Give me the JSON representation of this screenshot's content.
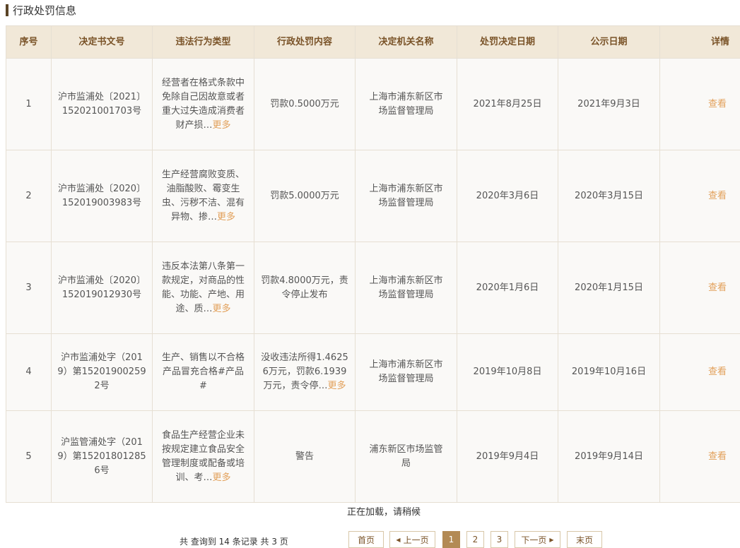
{
  "section_title": "行政处罚信息",
  "table": {
    "headers": [
      "序号",
      "决定书文号",
      "违法行为类型",
      "行政处罚内容",
      "决定机关名称",
      "处罚决定日期",
      "公示日期",
      "详情"
    ],
    "rows": [
      {
        "no": "1",
        "doc_no": "沪市监浦处〔2021〕152021001703号",
        "type": "经营者在格式条款中免除自己因故意或者重大过失造成消费者财产损…",
        "more": "更多",
        "content": "罚款0.5000万元",
        "authority": "上海市浦东新区市场监督管理局",
        "decision_date": "2021年8月25日",
        "publish_date": "2021年9月3日",
        "view": "查看"
      },
      {
        "no": "2",
        "doc_no": "沪市监浦处〔2020〕152019003983号",
        "type": "生产经营腐败变质、油脂酸败、霉变生虫、污秽不洁、混有异物、掺…",
        "more": "更多",
        "content": "罚款5.0000万元",
        "authority": "上海市浦东新区市场监督管理局",
        "decision_date": "2020年3月6日",
        "publish_date": "2020年3月15日",
        "view": "查看"
      },
      {
        "no": "3",
        "doc_no": "沪市监浦处〔2020〕152019012930号",
        "type": "违反本法第八条第一款规定，对商品的性能、功能、产地、用途、质…",
        "more": "更多",
        "content": "罚款4.8000万元，责令停止发布",
        "authority": "上海市浦东新区市场监督管理局",
        "decision_date": "2020年1月6日",
        "publish_date": "2020年1月15日",
        "view": "查看"
      },
      {
        "no": "4",
        "doc_no": "沪市监浦处字（2019）第152019002592号",
        "type": "生产、销售以不合格产品冒充合格#产品#",
        "more": "",
        "content": "没收违法所得1.46256万元，罚款6.1939万元，责令停…",
        "content_more": "更多",
        "authority": "上海市浦东新区市场监督管理局",
        "decision_date": "2019年10月8日",
        "publish_date": "2019年10月16日",
        "view": "查看"
      },
      {
        "no": "5",
        "doc_no": "沪监管浦处字（2019）第152018012856号",
        "type": "食品生产经营企业未按规定建立食品安全管理制度或配备或培训、考…",
        "more": "更多",
        "content": "警告",
        "authority": "浦东新区市场监管局",
        "decision_date": "2019年9月4日",
        "publish_date": "2019年9月14日",
        "view": "查看"
      }
    ]
  },
  "loading_text": "正在加载，请稍候",
  "pagination": {
    "summary": "共 查询到 14 条记录 共 3 页",
    "first": "首页",
    "prev": "上一页",
    "pages": [
      "1",
      "2",
      "3"
    ],
    "current": "1",
    "next": "下一页",
    "last": "末页"
  }
}
